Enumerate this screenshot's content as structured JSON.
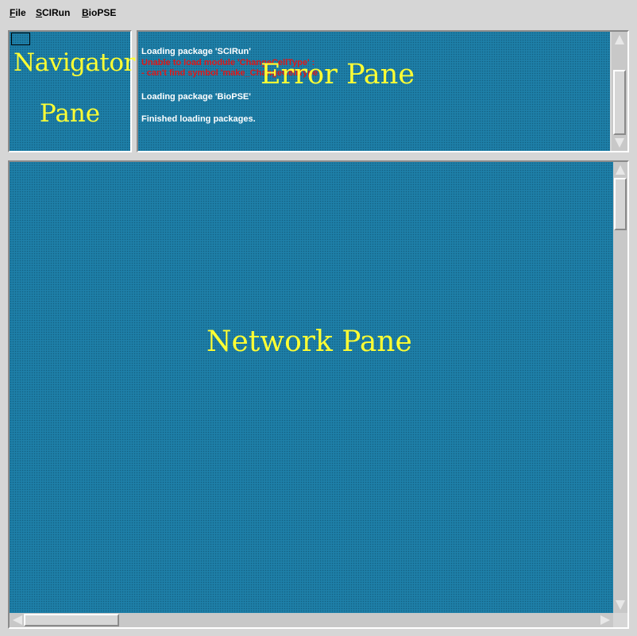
{
  "menubar": {
    "items": [
      {
        "mnemonic": "F",
        "rest": "ile"
      },
      {
        "mnemonic": "S",
        "rest": "CIRun"
      },
      {
        "mnemonic": "B",
        "rest": "ioPSE"
      }
    ]
  },
  "navigator": {
    "label_line1": "Navigator",
    "label_line2": "Pane"
  },
  "error_pane": {
    "label": "Error Pane",
    "log": [
      {
        "text": "Loading package 'SCIRun'",
        "level": "info"
      },
      {
        "text": "Unable to load module 'ChangeCellType' :",
        "level": "error"
      },
      {
        "text": "   - can't find symbol 'make_ChangeCellType'",
        "level": "error"
      },
      {
        "text": "Loading package 'BioPSE'",
        "level": "info"
      },
      {
        "text": "Finished loading packages.",
        "level": "info"
      }
    ]
  },
  "network_pane": {
    "label": "Network Pane"
  },
  "colors": {
    "canvas": "#1e7fa8",
    "label_yellow": "#ffff33",
    "error_red": "#e01818",
    "chrome": "#d6d6d6"
  }
}
